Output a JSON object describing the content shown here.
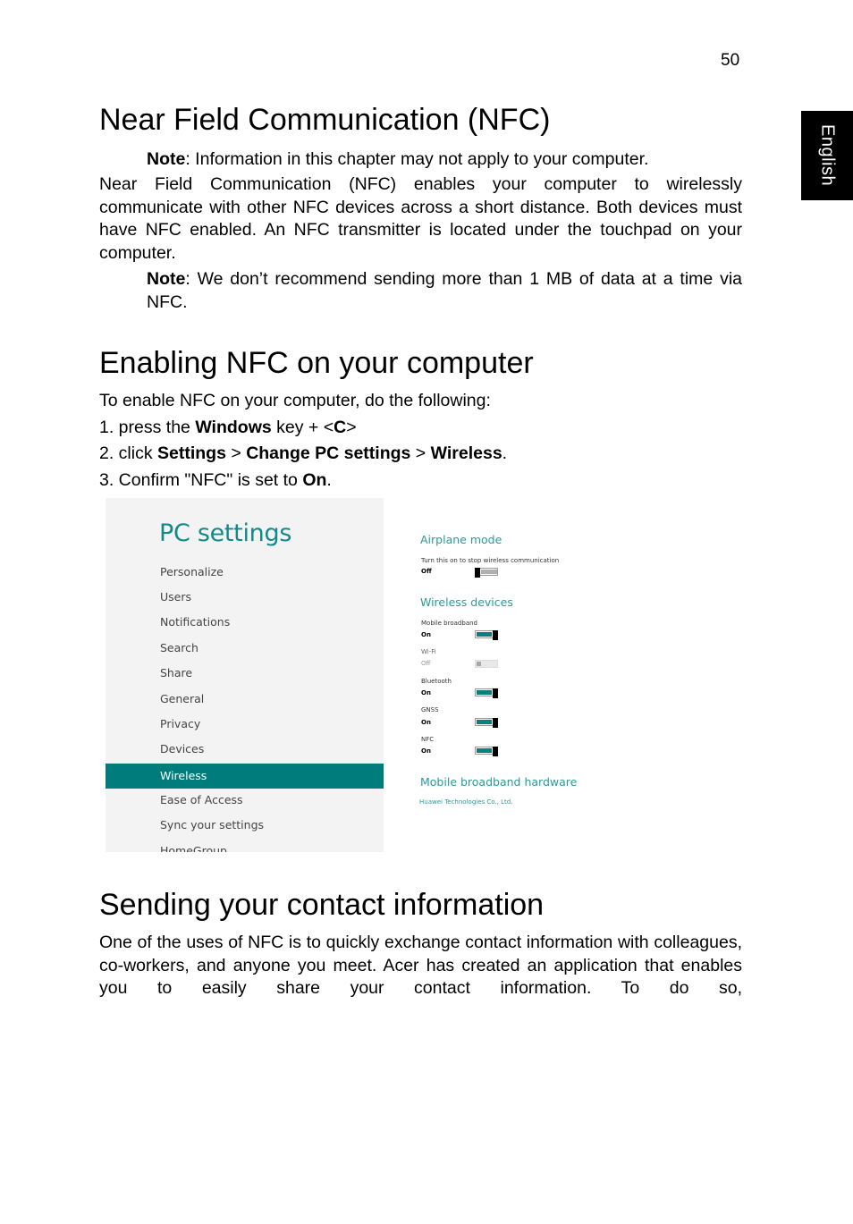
{
  "page": {
    "number": "50",
    "language_tab": "English"
  },
  "section1": {
    "title": "Near Field Communication (NFC)",
    "note1_label": "Note",
    "note1_text": ": Information in this chapter may not apply to your computer.",
    "body": "Near Field Communication (NFC) enables your computer to wirelessly communicate with other NFC devices across a short distance. Both devices must have NFC enabled. An NFC transmitter is located under the touchpad on your computer.",
    "note2_label": "Note",
    "note2_text": ": We don’t recommend sending more than 1 MB of data at a time via NFC."
  },
  "section2": {
    "title": "Enabling NFC on your computer",
    "intro": "To enable NFC on your computer, do the following:",
    "step1": {
      "prefix": "1. press the ",
      "b1": "Windows",
      "mid": " key + <",
      "b2": "C",
      "suffix": ">"
    },
    "step2": {
      "prefix": "2. click ",
      "b1": "Settings",
      "sep1": " > ",
      "b2": "Change PC settings",
      "sep2": " > ",
      "b3": "Wireless",
      "suffix": "."
    },
    "step3": {
      "prefix": "3. Confirm \"NFC\" is set to ",
      "b1": "On",
      "suffix": "."
    }
  },
  "screenshot": {
    "title": "PC settings",
    "nav": [
      "Personalize",
      "Users",
      "Notifications",
      "Search",
      "Share",
      "General",
      "Privacy",
      "Devices",
      "Wireless",
      "Ease of Access",
      "Sync your settings",
      "HomeGroup"
    ],
    "active_nav": "Wireless",
    "airplane": {
      "title": "Airplane mode",
      "desc": "Turn this on to stop wireless communication",
      "state": "Off"
    },
    "wireless_devices": {
      "title": "Wireless devices",
      "items": [
        {
          "name": "Mobile broadband",
          "state": "On"
        },
        {
          "name": "Wi-Fi",
          "state": "Off"
        },
        {
          "name": "Bluetooth",
          "state": "On"
        },
        {
          "name": "GNSS",
          "state": "On"
        },
        {
          "name": "NFC",
          "state": "On"
        }
      ]
    },
    "hardware": {
      "title": "Mobile broadband hardware",
      "vendor": "Huawei Technologies Co., Ltd."
    },
    "colors": {
      "accent": "#007c7c",
      "title": "#138a8a",
      "pane": "#f3f3f3"
    }
  },
  "section3": {
    "title": "Sending your contact information",
    "body": "One of the uses of NFC is to quickly exchange contact information with colleagues, co-workers, and anyone you meet. Acer has created an application that enables you to easily share your contact information. To do so,"
  }
}
